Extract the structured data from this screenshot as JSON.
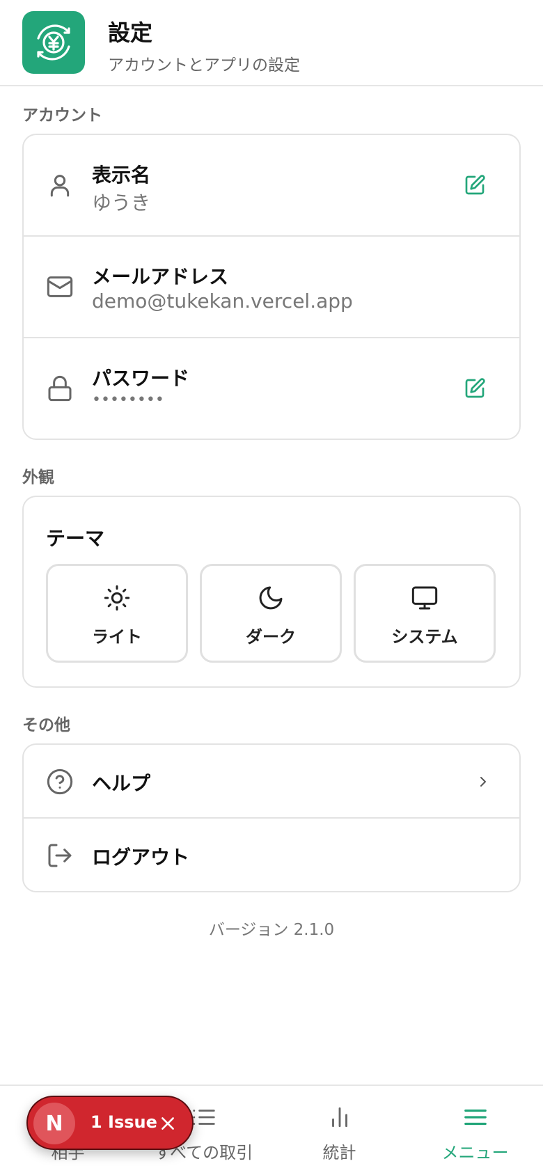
{
  "header": {
    "title": "設定",
    "subtitle": "アカウントとアプリの設定",
    "logo_icon": "yen-cycle-icon"
  },
  "account": {
    "section_label": "アカウント",
    "items": [
      {
        "label": "表示名",
        "value": "ゆうき",
        "icon": "user-icon",
        "editable": true
      },
      {
        "label": "メールアドレス",
        "value": "demo@tukekan.vercel.app",
        "icon": "mail-icon",
        "editable": false
      },
      {
        "label": "パスワード",
        "value": "••••••••",
        "icon": "lock-icon",
        "editable": true
      }
    ]
  },
  "appearance": {
    "section_label": "外観",
    "theme_title": "テーマ",
    "options": [
      {
        "label": "ライト",
        "icon": "sun-icon"
      },
      {
        "label": "ダーク",
        "icon": "moon-icon"
      },
      {
        "label": "システム",
        "icon": "monitor-icon"
      }
    ]
  },
  "other": {
    "section_label": "その他",
    "items": [
      {
        "label": "ヘルプ",
        "icon": "help-circle-icon"
      },
      {
        "label": "ログアウト",
        "icon": "logout-icon"
      }
    ]
  },
  "version": "バージョン 2.1.0",
  "bottom_nav": {
    "items": [
      {
        "label": "相手",
        "icon": "users-icon"
      },
      {
        "label": "すべての取引",
        "icon": "list-icon"
      },
      {
        "label": "統計",
        "icon": "bar-chart-icon"
      },
      {
        "label": "メニュー",
        "icon": "menu-icon",
        "active": true
      }
    ]
  },
  "dev_overlay": {
    "badge_letter": "N",
    "issue_text": "1 Issue"
  },
  "colors": {
    "accent": "#23a67a",
    "issue_red": "#d0262e"
  }
}
